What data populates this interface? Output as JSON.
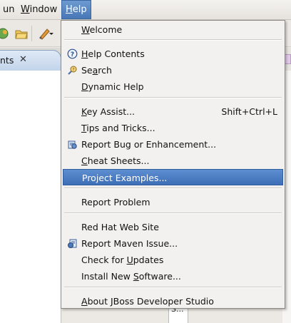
{
  "menubar": {
    "items": [
      {
        "label": "Run",
        "visible_text": "un",
        "mnemonic_index": -1
      },
      {
        "label": "Window",
        "visible_text": "Window"
      },
      {
        "label": "Help",
        "visible_text": "Help"
      }
    ]
  },
  "editor": {
    "tab_label": "nts",
    "close_glyph": "✕",
    "bottom_fragment": "S..."
  },
  "help_menu": {
    "items": [
      {
        "key": "welcome",
        "label": "Welcome",
        "mnemonic": "W",
        "icon": null
      },
      {
        "key": "help_contents",
        "label": "Help Contents",
        "mnemonic": "H",
        "icon": "question-circle-icon"
      },
      {
        "key": "search",
        "label": "Search",
        "mnemonic": "a",
        "icon": "search-help-icon"
      },
      {
        "key": "dynamic_help",
        "label": "Dynamic Help",
        "mnemonic": "D",
        "icon": null
      },
      {
        "key": "key_assist",
        "label": "Key Assist...",
        "mnemonic": "K",
        "accelerator": "Shift+Ctrl+L",
        "icon": null
      },
      {
        "key": "tips_tricks",
        "label": "Tips and Tricks...",
        "mnemonic": "T",
        "icon": null
      },
      {
        "key": "report_bug",
        "label": "Report Bug or Enhancement...",
        "mnemonic": null,
        "icon": "bug-report-icon"
      },
      {
        "key": "cheat_sheets",
        "label": "Cheat Sheets...",
        "mnemonic": "C",
        "icon": null
      },
      {
        "key": "project_examples",
        "label": "Project Examples...",
        "mnemonic": null,
        "icon": null,
        "highlighted": true
      },
      {
        "key": "report_problem",
        "label": "Report Problem",
        "mnemonic": null,
        "icon": null
      },
      {
        "key": "redhat_site",
        "label": "Red Hat Web Site",
        "mnemonic": null,
        "icon": null
      },
      {
        "key": "report_maven",
        "label": "Report Maven Issue...",
        "mnemonic": null,
        "icon": "maven-report-icon"
      },
      {
        "key": "check_updates",
        "label": "Check for Updates",
        "mnemonic": "U",
        "icon": null
      },
      {
        "key": "install_software",
        "label": "Install New Software...",
        "mnemonic": "S",
        "icon": null
      },
      {
        "key": "about",
        "label": "About JBoss Developer Studio",
        "mnemonic": "A",
        "icon": null
      }
    ]
  },
  "colors": {
    "highlight": "#4a7cc0",
    "menu_bg": "#f2f1ef",
    "menubar_bg": "#efece8"
  }
}
